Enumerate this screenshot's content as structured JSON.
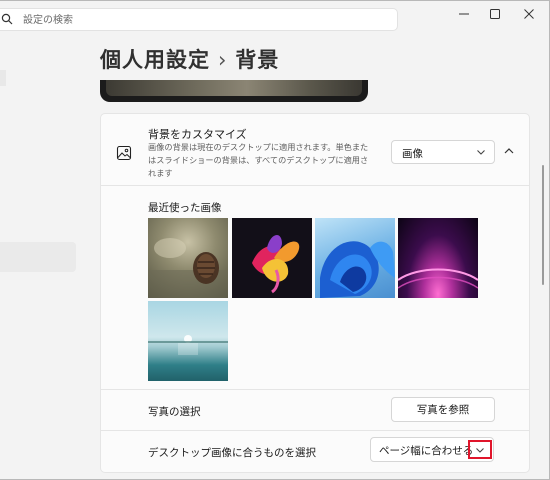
{
  "window": {
    "minimize_icon": "minimize-icon",
    "maximize_icon": "maximize-icon",
    "close_icon": "close-icon"
  },
  "search": {
    "placeholder": "設定の検索",
    "icon": "search-icon"
  },
  "breadcrumb": {
    "parent": "個人用設定",
    "separator": "›",
    "current": "背景"
  },
  "background_section": {
    "icon": "image-icon",
    "title": "背景をカスタマイズ",
    "description": "画像の背景は現在のデスクトップに適用されます。単色またはスライドショーの背景は、すべてのデスクトップに適用されます",
    "type_selected": "画像",
    "expanded": true
  },
  "recent_images": {
    "label": "最近使った画像",
    "count": 5
  },
  "choose_photo": {
    "label": "写真の選択",
    "button_label": "写真を参照"
  },
  "fit": {
    "label": "デスクトップ画像に合うものを選択",
    "selected": "ページ幅に合わせる",
    "highlight_color": "#e0152b"
  },
  "colors": {
    "background": "#f3f3f3",
    "panel": "#fbfbfb",
    "border": "#e5e5e5"
  }
}
